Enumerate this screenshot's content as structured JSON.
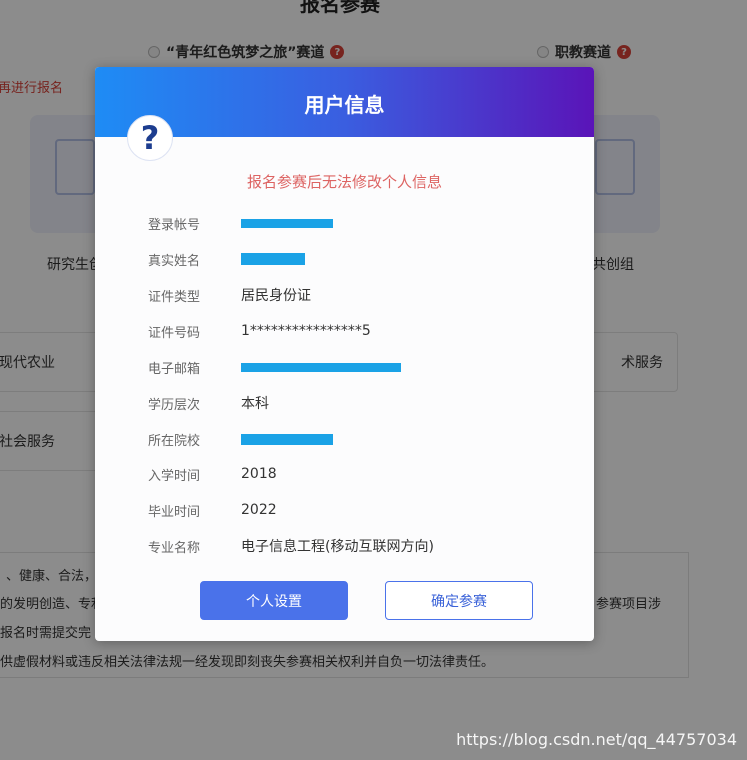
{
  "background": {
    "page_title": "报名参赛",
    "tracks": [
      {
        "label": "“青年红色筑梦之旅”赛道"
      },
      {
        "label": "职教赛道"
      }
    ],
    "help_glyph": "?",
    "notice": "再进行报名",
    "categories": [
      {
        "label": "研究生创"
      },
      {
        "label": "共创组"
      }
    ],
    "track_boxes": [
      {
        "label": "现代农业"
      },
      {
        "label": "术服务"
      },
      {
        "label": "社会服务"
      }
    ],
    "rules": [
      "、健康、合法，",
      "的发明创造、专利",
      "参赛项目涉",
      "报名时需提交完",
      "供虚假材料或违反相关法律法规一经发现即刻丧失参赛相关权利并自负一切法律责任。"
    ]
  },
  "modal": {
    "title": "用户信息",
    "help_icon": "?",
    "warning": "报名参赛后无法修改个人信息",
    "fields": [
      {
        "label": "登录帐号",
        "value": ""
      },
      {
        "label": "真实姓名",
        "value": ""
      },
      {
        "label": "证件类型",
        "value": "居民身份证"
      },
      {
        "label": "证件号码",
        "value": "1****************5"
      },
      {
        "label": "电子邮箱",
        "value": ""
      },
      {
        "label": "学历层次",
        "value": "本科"
      },
      {
        "label": "所在院校",
        "value": ""
      },
      {
        "label": "入学时间",
        "value": "2018"
      },
      {
        "label": "毕业时间",
        "value": "2022"
      },
      {
        "label": "专业名称",
        "value": "电子信息工程(移动互联网方向)"
      }
    ],
    "buttons": {
      "settings": "个人设置",
      "confirm": "确定参赛"
    }
  },
  "watermark": "https://blog.csdn.net/qq_44757034",
  "colors": {
    "header_start": "#1e8cf5",
    "header_end": "#5a14b8",
    "warning": "#dd6463",
    "primary": "#4a72ea",
    "redaction": "#1aa2e6"
  }
}
